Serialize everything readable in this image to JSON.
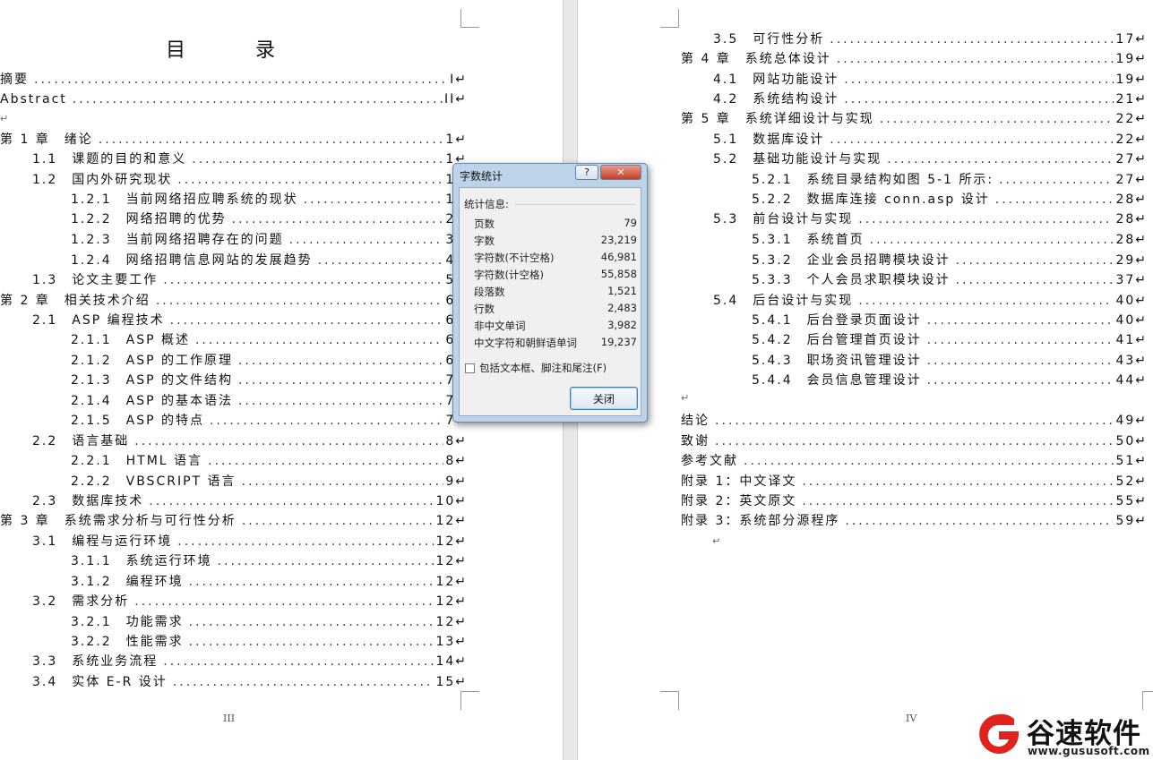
{
  "left_page": {
    "title": "目　录",
    "page_number": "III",
    "entries": [
      {
        "label": "摘要",
        "page": "I"
      },
      {
        "label": "Abstract",
        "page": "II"
      },
      {
        "label": "第 1 章　绪论",
        "page": "1"
      },
      {
        "label": "1.1　课题的目的和意义",
        "page": "1"
      },
      {
        "label": "1.2　国内外研究现状",
        "page": "1"
      },
      {
        "label": "1.2.1　当前网络招应聘系统的现状",
        "page": "1"
      },
      {
        "label": "1.2.2　网络招聘的优势",
        "page": "2"
      },
      {
        "label": "1.2.3　当前网络招聘存在的问题",
        "page": "3"
      },
      {
        "label": "1.2.4　网络招聘信息网站的发展趋势",
        "page": "4"
      },
      {
        "label": "1.3　论文主要工作",
        "page": "5"
      },
      {
        "label": "第 2 章　相关技术介绍",
        "page": "6"
      },
      {
        "label": "2.1　ASP 编程技术",
        "page": "6"
      },
      {
        "label": "2.1.1　ASP 概述",
        "page": "6"
      },
      {
        "label": "2.1.2　ASP 的工作原理",
        "page": "6"
      },
      {
        "label": "2.1.3　ASP 的文件结构",
        "page": "7"
      },
      {
        "label": "2.1.4　ASP 的基本语法",
        "page": "7"
      },
      {
        "label": "2.1.5　ASP 的特点",
        "page": "7"
      },
      {
        "label": "2.2　语言基础",
        "page": "8"
      },
      {
        "label": "2.2.1　HTML 语言",
        "page": "8"
      },
      {
        "label": "2.2.2　VBSCRIPT 语言",
        "page": "9"
      },
      {
        "label": "2.3　数据库技术",
        "page": "10"
      },
      {
        "label": "第 3 章　系统需求分析与可行性分析",
        "page": "12"
      },
      {
        "label": "3.1　编程与运行环境",
        "page": "12"
      },
      {
        "label": "3.1.1　系统运行环境",
        "page": "12"
      },
      {
        "label": "3.1.2　编程环境",
        "page": "12"
      },
      {
        "label": "3.2　需求分析",
        "page": "12"
      },
      {
        "label": "3.2.1　功能需求",
        "page": "12"
      },
      {
        "label": "3.2.2　性能需求",
        "page": "13"
      },
      {
        "label": "3.3　系统业务流程",
        "page": "14"
      },
      {
        "label": "3.4　实体 E-R 设计",
        "page": "15"
      }
    ]
  },
  "right_page": {
    "page_number": "IV",
    "entries": [
      {
        "label": "3.5　可行性分析",
        "page": "17"
      },
      {
        "label": "第 4 章　系统总体设计",
        "page": "19"
      },
      {
        "label": "4.1　网站功能设计",
        "page": "19"
      },
      {
        "label": "4.2　系统结构设计",
        "page": "21"
      },
      {
        "label": "第 5 章　系统详细设计与实现",
        "page": "22"
      },
      {
        "label": "5.1　数据库设计",
        "page": "22"
      },
      {
        "label": "5.2　基础功能设计与实现",
        "page": "27"
      },
      {
        "label": "5.2.1　系统目录结构如图 5-1 所示:",
        "page": "27"
      },
      {
        "label": "5.2.2　数据库连接 conn.asp 设计",
        "page": "28"
      },
      {
        "label": "5.3　前台设计与实现",
        "page": "28"
      },
      {
        "label": "5.3.1　系统首页",
        "page": "28"
      },
      {
        "label": "5.3.2　企业会员招聘模块设计",
        "page": "29"
      },
      {
        "label": "5.3.3　个人会员求职模块设计",
        "page": "37"
      },
      {
        "label": "5.4　后台设计与实现",
        "page": "40"
      },
      {
        "label": "5.4.1　后台登录页面设计",
        "page": "40"
      },
      {
        "label": "5.4.2　后台管理首页设计",
        "page": "41"
      },
      {
        "label": "5.4.3　职场资讯管理设计",
        "page": "43"
      },
      {
        "label": "5.4.4　会员信息管理设计",
        "page": "44"
      },
      {
        "label": "结论",
        "page": "49"
      },
      {
        "label": "致谢",
        "page": "50"
      },
      {
        "label": "参考文献",
        "page": "51"
      },
      {
        "label": "附录 1：中文译文",
        "page": "52"
      },
      {
        "label": "附录 2：英文原文",
        "page": "55"
      },
      {
        "label": "附录 3：系统部分源程序",
        "page": "59"
      }
    ]
  },
  "dialog": {
    "title": "字数统计",
    "help_label": "?",
    "close_x_label": "✕",
    "section_label": "统计信息:",
    "stats": [
      {
        "label": "页数",
        "value": "79"
      },
      {
        "label": "字数",
        "value": "23,219"
      },
      {
        "label": "字符数(不计空格)",
        "value": "46,981"
      },
      {
        "label": "字符数(计空格)",
        "value": "55,858"
      },
      {
        "label": "段落数",
        "value": "1,521"
      },
      {
        "label": "行数",
        "value": "2,483"
      },
      {
        "label": "非中文单词",
        "value": "3,982"
      },
      {
        "label": "中文字符和朝鲜语单词",
        "value": "19,237"
      }
    ],
    "checkbox_label": "包括文本框、脚注和尾注(F)",
    "checkbox_checked": false,
    "close_button": "关闭"
  },
  "watermark": {
    "brand": "谷速软件",
    "url": "www.gususoft.com",
    "brand_color": "#e0231d"
  },
  "paragraph_mark": "↵"
}
